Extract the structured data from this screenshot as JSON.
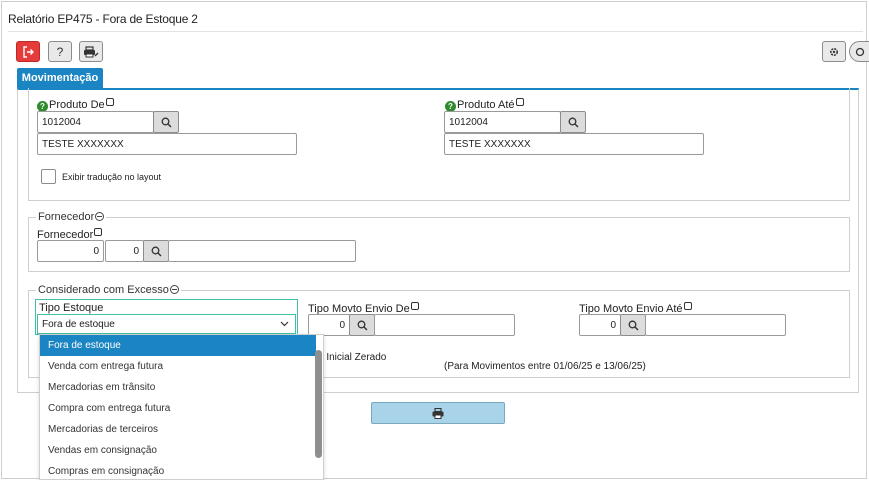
{
  "window": {
    "title": "Relatório EP475 - Fora de Estoque 2"
  },
  "toolbar": {
    "exit_icon": "exit-icon",
    "help_label": "?",
    "print_icon": "print-icon",
    "settings_icon": "gear-icon",
    "search_icon": "search-icon"
  },
  "tabs": [
    {
      "label": "Movimentação",
      "active": true
    }
  ],
  "produto": {
    "de": {
      "label": "Produto De",
      "code": "1012004",
      "description": "TESTE XXXXXXX"
    },
    "ate": {
      "label": "Produto Até",
      "code": "1012004",
      "description": "TESTE XXXXXXX"
    },
    "traducao_label": "Exibir tradução no layout"
  },
  "fornecedor": {
    "legend": "Fornecedor",
    "label": "Fornecedor",
    "value1": "0",
    "value2": "0",
    "name": ""
  },
  "excesso": {
    "legend": "Considerado com Excesso",
    "tipo_estoque": {
      "label": "Tipo Estoque",
      "selected": "Fora de estoque",
      "options": [
        "Fora de estoque",
        "Venda com entrega futura",
        "Mercadorias em trânsito",
        "Compra com entrega futura",
        "Mercadorias de terceiros",
        "Vendas em consignação",
        "Compras em consignação"
      ]
    },
    "movto_de": {
      "label": "Tipo Movto Envio De",
      "value": "0",
      "name": ""
    },
    "movto_ate": {
      "label": "Tipo Movto Envio Até",
      "value": "0",
      "name": ""
    },
    "saldo_label": "o Inicial Zerado",
    "periodo_text": "(Para Movimentos entre 01/06/25 e 13/06/25)"
  },
  "colors": {
    "accent": "#1b84c2",
    "exit": "#e53b3b",
    "focus_border": "#3fc0a4",
    "print_button": "#a9d3e8"
  }
}
